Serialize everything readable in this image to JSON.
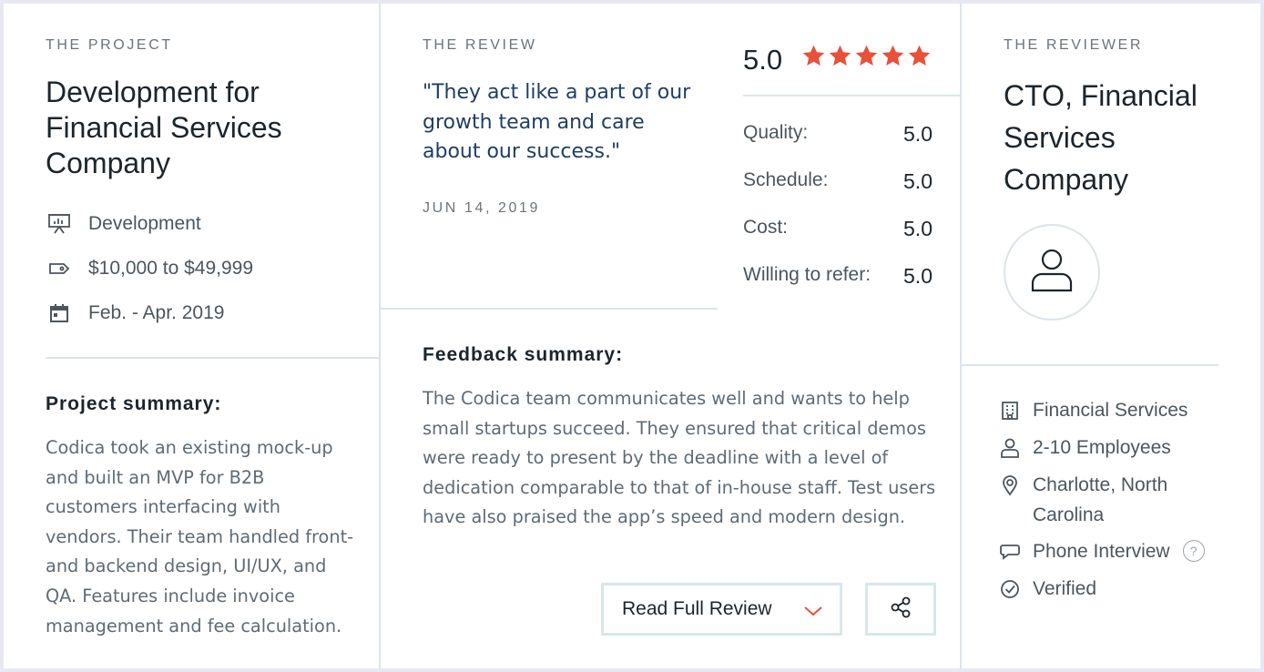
{
  "project": {
    "eyebrow": "THE PROJECT",
    "title": "Development for Financial Services Company",
    "service": "Development",
    "budget": "$10,000 to $49,999",
    "dates": "Feb. - Apr. 2019",
    "summary_heading": "Project summary:",
    "summary": "Codica took an existing mock-up and built an MVP for B2B customers interfacing with vendors. Their team handled front- and backend design, UI/UX, and QA. Features include invoice management and fee calculation."
  },
  "review": {
    "eyebrow": "THE REVIEW",
    "quote": "\"They act like a part of our growth team and care about our success.\"",
    "date": "JUN 14, 2019",
    "overall": "5.0",
    "stars": 5,
    "star_color": "#e8503a",
    "ratings": [
      {
        "label": "Quality:",
        "value": "5.0"
      },
      {
        "label": "Schedule:",
        "value": "5.0"
      },
      {
        "label": "Cost:",
        "value": "5.0"
      },
      {
        "label": "Willing to refer:",
        "value": "5.0"
      }
    ],
    "feedback_heading": "Feedback summary:",
    "feedback": "The Codica team communicates well and wants to help small startups succeed. They ensured that critical demos were ready to present by the deadline with a level of dedication comparable to that of in-house staff. Test users have also praised the app’s speed and modern design.",
    "read_full_label": "Read Full Review",
    "chevron_icon": "chevron-down-icon",
    "share_icon": "share-icon",
    "accent": "#e8503a"
  },
  "reviewer": {
    "eyebrow": "THE REVIEWER",
    "title": "CTO, Financial Services Company",
    "avatar_icon": "user-icon",
    "industry": "Financial Services",
    "size": "2-10 Employees",
    "location": "Charlotte, North Carolina",
    "interview": "Phone Interview",
    "help_glyph": "?",
    "verified": "Verified"
  }
}
